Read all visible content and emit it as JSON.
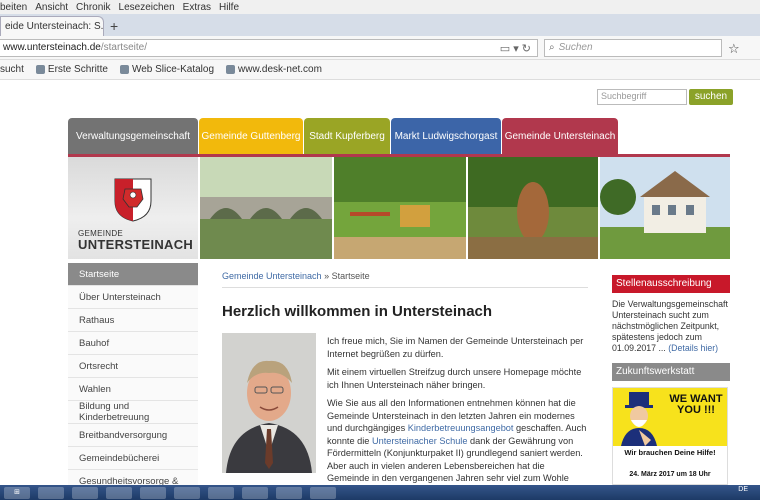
{
  "browser": {
    "menu": [
      "beiten",
      "Ansicht",
      "Chronik",
      "Lesezeichen",
      "Extras",
      "Hilfe"
    ],
    "tab_title": "eide Untersteinach: S...",
    "url_host": "www.untersteinach.de",
    "url_path": "/startseite/",
    "search_placeholder": "Suchen",
    "bookmarks": [
      "sucht",
      "Erste Schritte",
      "Web Slice-Katalog",
      "www.desk-net.com"
    ]
  },
  "site": {
    "search_placeholder": "Suchbegriff",
    "search_button": "suchen",
    "nav": [
      "Verwaltungsgemeinschaft",
      "Gemeinde Guttenberg",
      "Stadt Kupferberg",
      "Markt Ludwigschorgast",
      "Gemeinde Untersteinach"
    ],
    "logo": {
      "line1": "GEMEINDE",
      "line2": "UNTERSTEINACH"
    },
    "sidebar": [
      "Startseite",
      "Über Untersteinach",
      "Rathaus",
      "Bauhof",
      "Ortsrecht",
      "Wahlen",
      "Bildung und Kinderbetreuung",
      "Breitbandversorgung",
      "Gemeindebücherei",
      "Gesundheitsvorsorge &"
    ],
    "breadcrumb": {
      "link": "Gemeinde Untersteinach",
      "sep": "»",
      "current": "Startseite"
    },
    "title": "Herzlich willkommen in Untersteinach",
    "content": {
      "p1": "Ich freue mich, Sie im Namen der Gemeinde Untersteinach per Internet begrüßen zu dürfen.",
      "p2": "Mit einem virtuellen Streifzug durch unsere Homepage möchte ich Ihnen Untersteinach näher bringen.",
      "p3_a": "Wie Sie aus all den Informationen entnehmen können hat die Gemeinde Untersteinach in den letzten Jahren ein modernes und durchgängiges ",
      "p3_link1": "Kinderbetreuungsangebot",
      "p3_b": " geschaffen. Auch konnte die ",
      "p3_link2": "Untersteinacher Schule",
      "p3_c": " dank der Gewährung von Fördermitteln (Konjunkturpaket II) grundlegend saniert werden. Aber auch in vielen anderen Lebensbereichen hat die Gemeinde in den vergangenen Jahren sehr viel zum Wohle unserer Bevölkerung"
    },
    "right": {
      "box1_title": "Stellenausschreibung",
      "box1_text": "Die Verwaltungsgemeinschaft Untersteinach sucht zum nächstmöglichen Zeitpunkt, spätestens jedoch zum 01.09.2017 ... ",
      "box1_link": "(Details hier)",
      "box2_title": "Zukunftswerkstatt",
      "poster_want": "WE WANT YOU !!!",
      "poster_hilfe": "Wir brauchen Deine Hilfe!",
      "poster_date": "24. März 2017 um 18 Uhr"
    }
  },
  "taskbar": {
    "tray": "DE"
  }
}
